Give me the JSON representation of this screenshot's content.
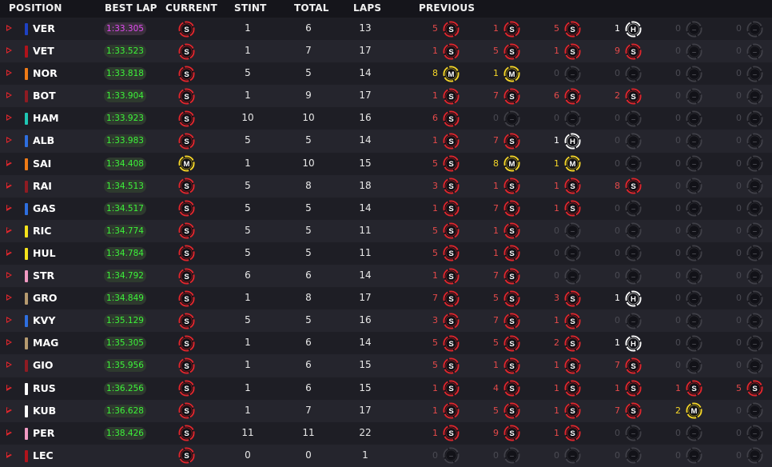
{
  "headers": {
    "position": "POSITION",
    "best_lap": "BEST LAP",
    "current": "CURRENT",
    "stint": "STINT",
    "total": "TOTAL",
    "laps": "LAPS",
    "previous": "PREVIOUS"
  },
  "colors": {
    "soft": "#e1262d",
    "medium": "#f5d628",
    "hard": "#ffffff",
    "empty": "#4a4a52",
    "fastest_lap": "#e14bf2",
    "lap_time": "#3df33a"
  },
  "tyre_letters": {
    "soft": "S",
    "medium": "M",
    "hard": "H"
  },
  "rows": [
    {
      "driver": "VER",
      "team_color": "#1e41c3",
      "best_lap": "1:33.305",
      "purple": true,
      "current": "soft",
      "stint": "1",
      "total": "6",
      "laps": "13",
      "previous": [
        {
          "laps": "5",
          "tyre": "soft"
        },
        {
          "laps": "1",
          "tyre": "soft"
        },
        {
          "laps": "5",
          "tyre": "soft"
        },
        {
          "laps": "1",
          "tyre": "hard"
        },
        {
          "laps": "0",
          "tyre": "empty"
        },
        {
          "laps": "0",
          "tyre": "empty"
        }
      ]
    },
    {
      "driver": "VET",
      "team_color": "#b0131b",
      "best_lap": "1:33.523",
      "current": "soft",
      "stint": "1",
      "total": "7",
      "laps": "17",
      "previous": [
        {
          "laps": "1",
          "tyre": "soft"
        },
        {
          "laps": "5",
          "tyre": "soft"
        },
        {
          "laps": "1",
          "tyre": "soft"
        },
        {
          "laps": "9",
          "tyre": "soft"
        },
        {
          "laps": "0",
          "tyre": "empty"
        },
        {
          "laps": "0",
          "tyre": "empty"
        }
      ]
    },
    {
      "driver": "NOR",
      "team_color": "#f07b16",
      "best_lap": "1:33.818",
      "current": "soft",
      "stint": "5",
      "total": "5",
      "laps": "14",
      "previous": [
        {
          "laps": "8",
          "tyre": "medium"
        },
        {
          "laps": "1",
          "tyre": "medium"
        },
        {
          "laps": "0",
          "tyre": "empty"
        },
        {
          "laps": "0",
          "tyre": "empty"
        },
        {
          "laps": "0",
          "tyre": "empty"
        },
        {
          "laps": "0",
          "tyre": "empty"
        }
      ]
    },
    {
      "driver": "BOT",
      "team_color": "#8f1b22",
      "best_lap": "1:33.904",
      "current": "soft",
      "stint": "1",
      "total": "9",
      "laps": "17",
      "previous": [
        {
          "laps": "1",
          "tyre": "soft"
        },
        {
          "laps": "7",
          "tyre": "soft"
        },
        {
          "laps": "6",
          "tyre": "soft"
        },
        {
          "laps": "2",
          "tyre": "soft"
        },
        {
          "laps": "0",
          "tyre": "empty"
        },
        {
          "laps": "0",
          "tyre": "empty"
        }
      ]
    },
    {
      "driver": "HAM",
      "team_color": "#1fc7b4",
      "best_lap": "1:33.923",
      "current": "soft",
      "stint": "10",
      "total": "10",
      "laps": "16",
      "previous": [
        {
          "laps": "6",
          "tyre": "soft"
        },
        {
          "laps": "0",
          "tyre": "empty"
        },
        {
          "laps": "0",
          "tyre": "empty"
        },
        {
          "laps": "0",
          "tyre": "empty"
        },
        {
          "laps": "0",
          "tyre": "empty"
        },
        {
          "laps": "0",
          "tyre": "empty"
        }
      ]
    },
    {
      "driver": "ALB",
      "team_color": "#2e6fe0",
      "best_lap": "1:33.983",
      "current": "soft",
      "stint": "5",
      "total": "5",
      "laps": "14",
      "previous": [
        {
          "laps": "1",
          "tyre": "soft"
        },
        {
          "laps": "7",
          "tyre": "soft"
        },
        {
          "laps": "1",
          "tyre": "hard"
        },
        {
          "laps": "0",
          "tyre": "empty"
        },
        {
          "laps": "0",
          "tyre": "empty"
        },
        {
          "laps": "0",
          "tyre": "empty"
        }
      ]
    },
    {
      "driver": "SAI",
      "team_color": "#f07b16",
      "best_lap": "1:34.408",
      "current": "medium",
      "stint": "1",
      "total": "10",
      "laps": "15",
      "previous": [
        {
          "laps": "5",
          "tyre": "soft"
        },
        {
          "laps": "8",
          "tyre": "medium"
        },
        {
          "laps": "1",
          "tyre": "medium"
        },
        {
          "laps": "0",
          "tyre": "empty"
        },
        {
          "laps": "0",
          "tyre": "empty"
        },
        {
          "laps": "0",
          "tyre": "empty"
        }
      ]
    },
    {
      "driver": "RAI",
      "team_color": "#8f1b22",
      "best_lap": "1:34.513",
      "current": "soft",
      "stint": "5",
      "total": "8",
      "laps": "18",
      "previous": [
        {
          "laps": "3",
          "tyre": "soft"
        },
        {
          "laps": "1",
          "tyre": "soft"
        },
        {
          "laps": "1",
          "tyre": "soft"
        },
        {
          "laps": "8",
          "tyre": "soft"
        },
        {
          "laps": "0",
          "tyre": "empty"
        },
        {
          "laps": "0",
          "tyre": "empty"
        }
      ]
    },
    {
      "driver": "GAS",
      "team_color": "#2e6fe0",
      "best_lap": "1:34.517",
      "current": "soft",
      "stint": "5",
      "total": "5",
      "laps": "14",
      "previous": [
        {
          "laps": "1",
          "tyre": "soft"
        },
        {
          "laps": "7",
          "tyre": "soft"
        },
        {
          "laps": "1",
          "tyre": "soft"
        },
        {
          "laps": "0",
          "tyre": "empty"
        },
        {
          "laps": "0",
          "tyre": "empty"
        },
        {
          "laps": "0",
          "tyre": "empty"
        }
      ]
    },
    {
      "driver": "RIC",
      "team_color": "#f5e31b",
      "best_lap": "1:34.774",
      "current": "soft",
      "stint": "5",
      "total": "5",
      "laps": "11",
      "previous": [
        {
          "laps": "5",
          "tyre": "soft"
        },
        {
          "laps": "1",
          "tyre": "soft"
        },
        {
          "laps": "0",
          "tyre": "empty"
        },
        {
          "laps": "0",
          "tyre": "empty"
        },
        {
          "laps": "0",
          "tyre": "empty"
        },
        {
          "laps": "0",
          "tyre": "empty"
        }
      ]
    },
    {
      "driver": "HUL",
      "team_color": "#f5e31b",
      "best_lap": "1:34.784",
      "current": "soft",
      "stint": "5",
      "total": "5",
      "laps": "11",
      "previous": [
        {
          "laps": "5",
          "tyre": "soft"
        },
        {
          "laps": "1",
          "tyre": "soft"
        },
        {
          "laps": "0",
          "tyre": "empty"
        },
        {
          "laps": "0",
          "tyre": "empty"
        },
        {
          "laps": "0",
          "tyre": "empty"
        },
        {
          "laps": "0",
          "tyre": "empty"
        }
      ]
    },
    {
      "driver": "STR",
      "team_color": "#f29ac3",
      "best_lap": "1:34.792",
      "current": "soft",
      "stint": "6",
      "total": "6",
      "laps": "14",
      "previous": [
        {
          "laps": "1",
          "tyre": "soft"
        },
        {
          "laps": "7",
          "tyre": "soft"
        },
        {
          "laps": "0",
          "tyre": "empty"
        },
        {
          "laps": "0",
          "tyre": "empty"
        },
        {
          "laps": "0",
          "tyre": "empty"
        },
        {
          "laps": "0",
          "tyre": "empty"
        }
      ]
    },
    {
      "driver": "GRO",
      "team_color": "#b69a6f",
      "best_lap": "1:34.849",
      "current": "soft",
      "stint": "1",
      "total": "8",
      "laps": "17",
      "previous": [
        {
          "laps": "7",
          "tyre": "soft"
        },
        {
          "laps": "5",
          "tyre": "soft"
        },
        {
          "laps": "3",
          "tyre": "soft"
        },
        {
          "laps": "1",
          "tyre": "hard"
        },
        {
          "laps": "0",
          "tyre": "empty"
        },
        {
          "laps": "0",
          "tyre": "empty"
        }
      ]
    },
    {
      "driver": "KVY",
      "team_color": "#2e6fe0",
      "best_lap": "1:35.129",
      "current": "soft",
      "stint": "5",
      "total": "5",
      "laps": "16",
      "previous": [
        {
          "laps": "3",
          "tyre": "soft"
        },
        {
          "laps": "7",
          "tyre": "soft"
        },
        {
          "laps": "1",
          "tyre": "soft"
        },
        {
          "laps": "0",
          "tyre": "empty"
        },
        {
          "laps": "0",
          "tyre": "empty"
        },
        {
          "laps": "0",
          "tyre": "empty"
        }
      ]
    },
    {
      "driver": "MAG",
      "team_color": "#b69a6f",
      "best_lap": "1:35.305",
      "current": "soft",
      "stint": "1",
      "total": "6",
      "laps": "14",
      "previous": [
        {
          "laps": "5",
          "tyre": "soft"
        },
        {
          "laps": "5",
          "tyre": "soft"
        },
        {
          "laps": "2",
          "tyre": "soft"
        },
        {
          "laps": "1",
          "tyre": "hard"
        },
        {
          "laps": "0",
          "tyre": "empty"
        },
        {
          "laps": "0",
          "tyre": "empty"
        }
      ]
    },
    {
      "driver": "GIO",
      "team_color": "#8f1b22",
      "best_lap": "1:35.956",
      "current": "soft",
      "stint": "1",
      "total": "6",
      "laps": "15",
      "previous": [
        {
          "laps": "5",
          "tyre": "soft"
        },
        {
          "laps": "1",
          "tyre": "soft"
        },
        {
          "laps": "1",
          "tyre": "soft"
        },
        {
          "laps": "7",
          "tyre": "soft"
        },
        {
          "laps": "0",
          "tyre": "empty"
        },
        {
          "laps": "0",
          "tyre": "empty"
        }
      ]
    },
    {
      "driver": "RUS",
      "team_color": "#ffffff",
      "best_lap": "1:36.256",
      "current": "soft",
      "stint": "1",
      "total": "6",
      "laps": "15",
      "previous": [
        {
          "laps": "1",
          "tyre": "soft"
        },
        {
          "laps": "4",
          "tyre": "soft"
        },
        {
          "laps": "1",
          "tyre": "soft"
        },
        {
          "laps": "1",
          "tyre": "soft"
        },
        {
          "laps": "1",
          "tyre": "soft"
        },
        {
          "laps": "5",
          "tyre": "soft"
        }
      ]
    },
    {
      "driver": "KUB",
      "team_color": "#ffffff",
      "best_lap": "1:36.628",
      "current": "soft",
      "stint": "1",
      "total": "7",
      "laps": "17",
      "previous": [
        {
          "laps": "1",
          "tyre": "soft"
        },
        {
          "laps": "5",
          "tyre": "soft"
        },
        {
          "laps": "1",
          "tyre": "soft"
        },
        {
          "laps": "7",
          "tyre": "soft"
        },
        {
          "laps": "2",
          "tyre": "medium"
        },
        {
          "laps": "0",
          "tyre": "empty"
        }
      ]
    },
    {
      "driver": "PER",
      "team_color": "#f29ac3",
      "best_lap": "1:38.426",
      "current": "soft",
      "stint": "11",
      "total": "11",
      "laps": "22",
      "previous": [
        {
          "laps": "1",
          "tyre": "soft"
        },
        {
          "laps": "9",
          "tyre": "soft"
        },
        {
          "laps": "1",
          "tyre": "soft"
        },
        {
          "laps": "0",
          "tyre": "empty"
        },
        {
          "laps": "0",
          "tyre": "empty"
        },
        {
          "laps": "0",
          "tyre": "empty"
        }
      ]
    },
    {
      "driver": "LEC",
      "team_color": "#b0131b",
      "best_lap": "",
      "current": "soft",
      "stint": "0",
      "total": "0",
      "laps": "1",
      "previous": [
        {
          "laps": "0",
          "tyre": "empty"
        },
        {
          "laps": "0",
          "tyre": "empty"
        },
        {
          "laps": "0",
          "tyre": "empty"
        },
        {
          "laps": "0",
          "tyre": "empty"
        },
        {
          "laps": "0",
          "tyre": "empty"
        },
        {
          "laps": "0",
          "tyre": "empty"
        }
      ]
    }
  ]
}
